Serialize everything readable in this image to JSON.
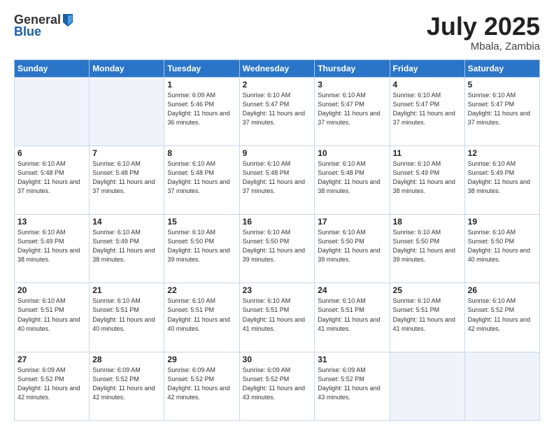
{
  "header": {
    "logo_general": "General",
    "logo_blue": "Blue",
    "month_year": "July 2025",
    "location": "Mbala, Zambia"
  },
  "weekdays": [
    "Sunday",
    "Monday",
    "Tuesday",
    "Wednesday",
    "Thursday",
    "Friday",
    "Saturday"
  ],
  "weeks": [
    [
      {
        "day": "",
        "empty": true
      },
      {
        "day": "",
        "empty": true
      },
      {
        "day": "1",
        "sunrise": "Sunrise: 6:09 AM",
        "sunset": "Sunset: 5:46 PM",
        "daylight": "Daylight: 11 hours and 36 minutes."
      },
      {
        "day": "2",
        "sunrise": "Sunrise: 6:10 AM",
        "sunset": "Sunset: 5:47 PM",
        "daylight": "Daylight: 11 hours and 37 minutes."
      },
      {
        "day": "3",
        "sunrise": "Sunrise: 6:10 AM",
        "sunset": "Sunset: 5:47 PM",
        "daylight": "Daylight: 11 hours and 37 minutes."
      },
      {
        "day": "4",
        "sunrise": "Sunrise: 6:10 AM",
        "sunset": "Sunset: 5:47 PM",
        "daylight": "Daylight: 11 hours and 37 minutes."
      },
      {
        "day": "5",
        "sunrise": "Sunrise: 6:10 AM",
        "sunset": "Sunset: 5:47 PM",
        "daylight": "Daylight: 11 hours and 37 minutes."
      }
    ],
    [
      {
        "day": "6",
        "sunrise": "Sunrise: 6:10 AM",
        "sunset": "Sunset: 5:48 PM",
        "daylight": "Daylight: 11 hours and 37 minutes."
      },
      {
        "day": "7",
        "sunrise": "Sunrise: 6:10 AM",
        "sunset": "Sunset: 5:48 PM",
        "daylight": "Daylight: 11 hours and 37 minutes."
      },
      {
        "day": "8",
        "sunrise": "Sunrise: 6:10 AM",
        "sunset": "Sunset: 5:48 PM",
        "daylight": "Daylight: 11 hours and 37 minutes."
      },
      {
        "day": "9",
        "sunrise": "Sunrise: 6:10 AM",
        "sunset": "Sunset: 5:48 PM",
        "daylight": "Daylight: 11 hours and 37 minutes."
      },
      {
        "day": "10",
        "sunrise": "Sunrise: 6:10 AM",
        "sunset": "Sunset: 5:48 PM",
        "daylight": "Daylight: 11 hours and 38 minutes."
      },
      {
        "day": "11",
        "sunrise": "Sunrise: 6:10 AM",
        "sunset": "Sunset: 5:49 PM",
        "daylight": "Daylight: 11 hours and 38 minutes."
      },
      {
        "day": "12",
        "sunrise": "Sunrise: 6:10 AM",
        "sunset": "Sunset: 5:49 PM",
        "daylight": "Daylight: 11 hours and 38 minutes."
      }
    ],
    [
      {
        "day": "13",
        "sunrise": "Sunrise: 6:10 AM",
        "sunset": "Sunset: 5:49 PM",
        "daylight": "Daylight: 11 hours and 38 minutes."
      },
      {
        "day": "14",
        "sunrise": "Sunrise: 6:10 AM",
        "sunset": "Sunset: 5:49 PM",
        "daylight": "Daylight: 11 hours and 38 minutes."
      },
      {
        "day": "15",
        "sunrise": "Sunrise: 6:10 AM",
        "sunset": "Sunset: 5:50 PM",
        "daylight": "Daylight: 11 hours and 39 minutes."
      },
      {
        "day": "16",
        "sunrise": "Sunrise: 6:10 AM",
        "sunset": "Sunset: 5:50 PM",
        "daylight": "Daylight: 11 hours and 39 minutes."
      },
      {
        "day": "17",
        "sunrise": "Sunrise: 6:10 AM",
        "sunset": "Sunset: 5:50 PM",
        "daylight": "Daylight: 11 hours and 39 minutes."
      },
      {
        "day": "18",
        "sunrise": "Sunrise: 6:10 AM",
        "sunset": "Sunset: 5:50 PM",
        "daylight": "Daylight: 11 hours and 39 minutes."
      },
      {
        "day": "19",
        "sunrise": "Sunrise: 6:10 AM",
        "sunset": "Sunset: 5:50 PM",
        "daylight": "Daylight: 11 hours and 40 minutes."
      }
    ],
    [
      {
        "day": "20",
        "sunrise": "Sunrise: 6:10 AM",
        "sunset": "Sunset: 5:51 PM",
        "daylight": "Daylight: 11 hours and 40 minutes."
      },
      {
        "day": "21",
        "sunrise": "Sunrise: 6:10 AM",
        "sunset": "Sunset: 5:51 PM",
        "daylight": "Daylight: 11 hours and 40 minutes."
      },
      {
        "day": "22",
        "sunrise": "Sunrise: 6:10 AM",
        "sunset": "Sunset: 5:51 PM",
        "daylight": "Daylight: 11 hours and 40 minutes."
      },
      {
        "day": "23",
        "sunrise": "Sunrise: 6:10 AM",
        "sunset": "Sunset: 5:51 PM",
        "daylight": "Daylight: 11 hours and 41 minutes."
      },
      {
        "day": "24",
        "sunrise": "Sunrise: 6:10 AM",
        "sunset": "Sunset: 5:51 PM",
        "daylight": "Daylight: 11 hours and 41 minutes."
      },
      {
        "day": "25",
        "sunrise": "Sunrise: 6:10 AM",
        "sunset": "Sunset: 5:51 PM",
        "daylight": "Daylight: 11 hours and 41 minutes."
      },
      {
        "day": "26",
        "sunrise": "Sunrise: 6:10 AM",
        "sunset": "Sunset: 5:52 PM",
        "daylight": "Daylight: 11 hours and 42 minutes."
      }
    ],
    [
      {
        "day": "27",
        "sunrise": "Sunrise: 6:09 AM",
        "sunset": "Sunset: 5:52 PM",
        "daylight": "Daylight: 11 hours and 42 minutes."
      },
      {
        "day": "28",
        "sunrise": "Sunrise: 6:09 AM",
        "sunset": "Sunset: 5:52 PM",
        "daylight": "Daylight: 11 hours and 42 minutes."
      },
      {
        "day": "29",
        "sunrise": "Sunrise: 6:09 AM",
        "sunset": "Sunset: 5:52 PM",
        "daylight": "Daylight: 11 hours and 42 minutes."
      },
      {
        "day": "30",
        "sunrise": "Sunrise: 6:09 AM",
        "sunset": "Sunset: 5:52 PM",
        "daylight": "Daylight: 11 hours and 43 minutes."
      },
      {
        "day": "31",
        "sunrise": "Sunrise: 6:09 AM",
        "sunset": "Sunset: 5:52 PM",
        "daylight": "Daylight: 11 hours and 43 minutes."
      },
      {
        "day": "",
        "empty": true
      },
      {
        "day": "",
        "empty": true
      }
    ]
  ]
}
